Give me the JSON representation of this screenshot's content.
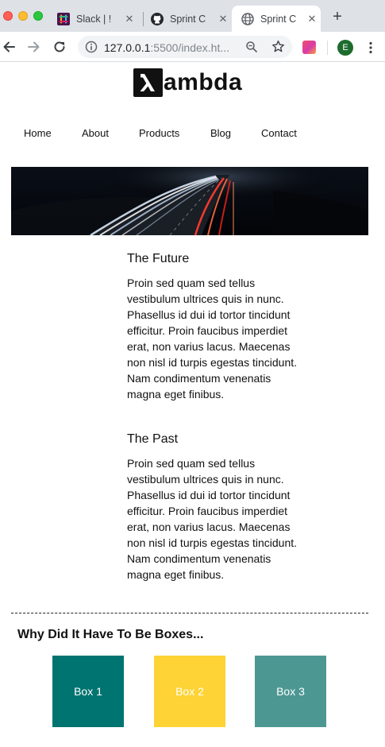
{
  "browser": {
    "tabs": [
      {
        "title": "Slack | !",
        "favicon": "slack-icon",
        "active": false
      },
      {
        "title": "Sprint C",
        "favicon": "github-icon",
        "active": false
      },
      {
        "title": "Sprint C",
        "favicon": "globe-icon",
        "active": true
      }
    ],
    "new_tab_label": "+",
    "url_host": "127.0.0.1",
    "url_rest": ":5500/index.ht...",
    "profile_initial": "E"
  },
  "site": {
    "logo_text": "ambda",
    "nav": [
      "Home",
      "About",
      "Products",
      "Blog",
      "Contact"
    ],
    "hero_image": "highway-light-trails",
    "articles": [
      {
        "heading": "The Future",
        "body": "Proin sed quam sed tellus vestibulum ultrices quis in nunc. Phasellus id dui id tortor tincidunt efficitur. Proin faucibus imperdiet erat, non varius lacus. Maecenas non nisl id turpis egestas tincidunt. Nam condimentum venenatis magna eget finibus."
      },
      {
        "heading": "The Past",
        "body": "Proin sed quam sed tellus vestibulum ultrices quis in nunc. Phasellus id dui id tortor tincidunt efficitur. Proin faucibus imperdiet erat, non varius lacus. Maecenas non nisl id turpis egestas tincidunt. Nam condimentum venenatis magna eget finibus."
      }
    ],
    "boxes_title": "Why Did It Have To Be Boxes...",
    "boxes": [
      {
        "label": "Box 1",
        "color": "#007470"
      },
      {
        "label": "Box 2",
        "color": "#fdd335"
      },
      {
        "label": "Box 3",
        "color": "#4d9793"
      }
    ]
  }
}
